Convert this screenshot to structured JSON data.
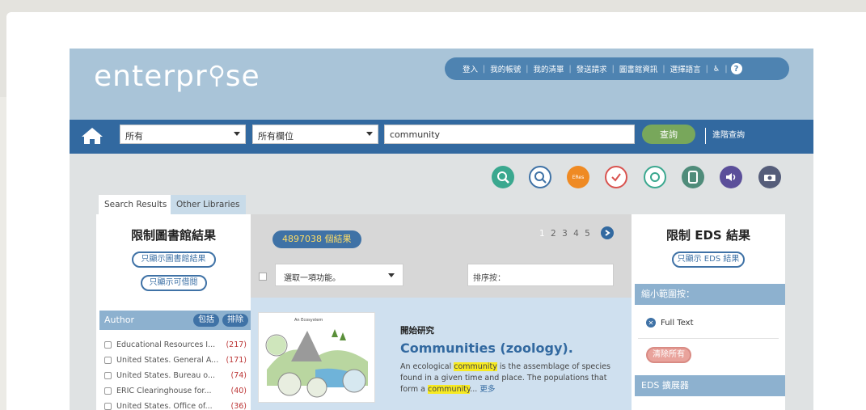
{
  "logo": {
    "text": "enterprise"
  },
  "topnav": {
    "items": [
      "登入",
      "我的帳號",
      "我的清單",
      "發送請求",
      "圖書館資訊",
      "選擇語言"
    ],
    "accessibility_icon": "accessibility-icon",
    "help_icon": "help-icon"
  },
  "search": {
    "scope": "所有",
    "field": "所有欄位",
    "query": "community",
    "submit": "查詢",
    "advanced": "進階查詢"
  },
  "service_icons": [
    {
      "name": "search-zoom-icon",
      "color": "#3aa88f"
    },
    {
      "name": "help-search-icon",
      "color": "#3f72a6"
    },
    {
      "name": "eres-icon",
      "label": "ERes",
      "color": "#ef8a23"
    },
    {
      "name": "checklist-icon",
      "color": "#d9534f"
    },
    {
      "name": "network-icon",
      "color": "#3aa88f"
    },
    {
      "name": "tablet-icon",
      "color": "#4f8c7a"
    },
    {
      "name": "audio-icon",
      "color": "#5b4f9a"
    },
    {
      "name": "camera-icon",
      "color": "#555d7a"
    }
  ],
  "tabs": [
    "Search Results",
    "Other Libraries"
  ],
  "left_panel": {
    "title": "限制圖書館結果",
    "btn_library": "只顯示圖書館結果",
    "btn_available": "只顯示可借閱",
    "facet_title": "Author",
    "include": "包括",
    "exclude": "排除",
    "facets": [
      {
        "name": "Educational Resources I...",
        "count": "(217)"
      },
      {
        "name": "United States. General A...",
        "count": "(171)"
      },
      {
        "name": "United States. Bureau o...",
        "count": "(74)"
      },
      {
        "name": "ERIC Clearinghouse for...",
        "count": "(40)"
      },
      {
        "name": "United States. Office of...",
        "count": "(36)"
      }
    ]
  },
  "center": {
    "result_count": "4897038 個結果",
    "pages": [
      "1",
      "2",
      "3",
      "4",
      "5"
    ],
    "bulk_action": "選取一項功能。",
    "sort_label": "排序按：",
    "result": {
      "kicker": "開始研究",
      "title": "Communities (zoology).",
      "snippet_1": "An ecological ",
      "hl_1": "community",
      "snippet_2": " is the assemblage of species found in a given time and place. The populations that form a ",
      "hl_2": "community",
      "snippet_3": "...",
      "more": "更多",
      "thumb_title": "An Ecosystem"
    }
  },
  "right_panel": {
    "title": "限制 EDS 結果",
    "btn_eds": "只顯示 EDS 結果",
    "narrow_head": "縮小範圍按：",
    "full_text": "Full Text",
    "clear_all": "清除所有",
    "expander_head": "EDS 擴展器"
  }
}
